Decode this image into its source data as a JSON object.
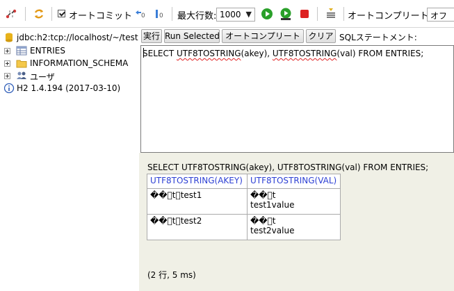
{
  "toolbar": {
    "autocommit_label": "オートコミット",
    "autocommit_checked": true,
    "max_rows_label": "最大行数:",
    "max_rows_value": "1000",
    "autocomplete_label": "オートコンプリート",
    "autocomplete_value": "オフ"
  },
  "sidebar": {
    "connection": "jdbc:h2:tcp://localhost/~/test",
    "items": [
      {
        "label": "ENTRIES"
      },
      {
        "label": "INFORMATION_SCHEMA"
      },
      {
        "label": "ユーザ"
      }
    ],
    "version": "H2 1.4.194 (2017-03-10)"
  },
  "editor_toolbar": {
    "run_label": "実行",
    "run_selected_label": "Run Selected",
    "autocomplete_label": "オートコンプリート",
    "clear_label": "クリア",
    "sql_statement_label": "SQLステートメント:"
  },
  "editor": {
    "sql_parts": {
      "p1": "SELECT ",
      "f1": "UTF8TOSTRING",
      "p2": "(akey), ",
      "f2": "UTF8TOSTRING",
      "p3": "(val) FROM ENTRIES;"
    }
  },
  "result": {
    "query": "SELECT UTF8TOSTRING(akey), UTF8TOSTRING(val) FROM ENTRIES;",
    "columns": [
      "UTF8TOSTRING(AKEY)",
      "UTF8TOSTRING(VAL)"
    ],
    "rows": [
      {
        "akey": "��\u0000t\u0000test1",
        "val_line1": "��\u0000t",
        "val_line2": "test1value"
      },
      {
        "akey": "��\u0000t\u0000test2",
        "val_line1": "��\u0000t",
        "val_line2": "test2value"
      }
    ],
    "status": "(2 行, 5 ms)"
  },
  "colors": {
    "header_link": "#2d40d4",
    "result_bg": "#f0f0e6",
    "run_green": "#2aa02a",
    "stop_red": "#dd2222"
  }
}
